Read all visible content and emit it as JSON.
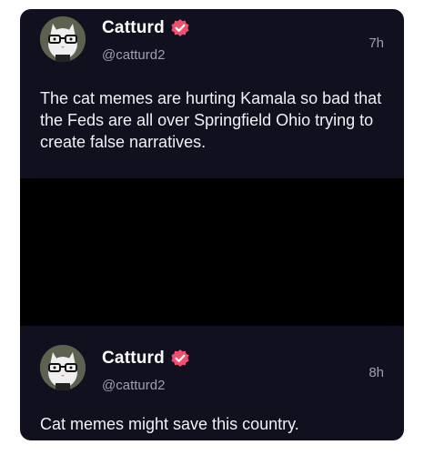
{
  "posts": [
    {
      "display_name": "Catturd",
      "handle": "@catturd2",
      "time": "7h",
      "text": "The cat memes are hurting Kamala so bad that the Feds are all over Springfield Ohio trying to create false narratives.",
      "verified": true
    },
    {
      "display_name": "Catturd",
      "handle": "@catturd2",
      "time": "8h",
      "text": "Cat memes might save this country.",
      "verified": true
    }
  ],
  "colors": {
    "background": "#10101f",
    "verified_badge": "#f0506e",
    "secondary_text": "#9aa0b4",
    "redaction": "#000000"
  },
  "icons": {
    "verified": "verified-badge-icon",
    "avatar": "cat-with-glasses-avatar"
  }
}
